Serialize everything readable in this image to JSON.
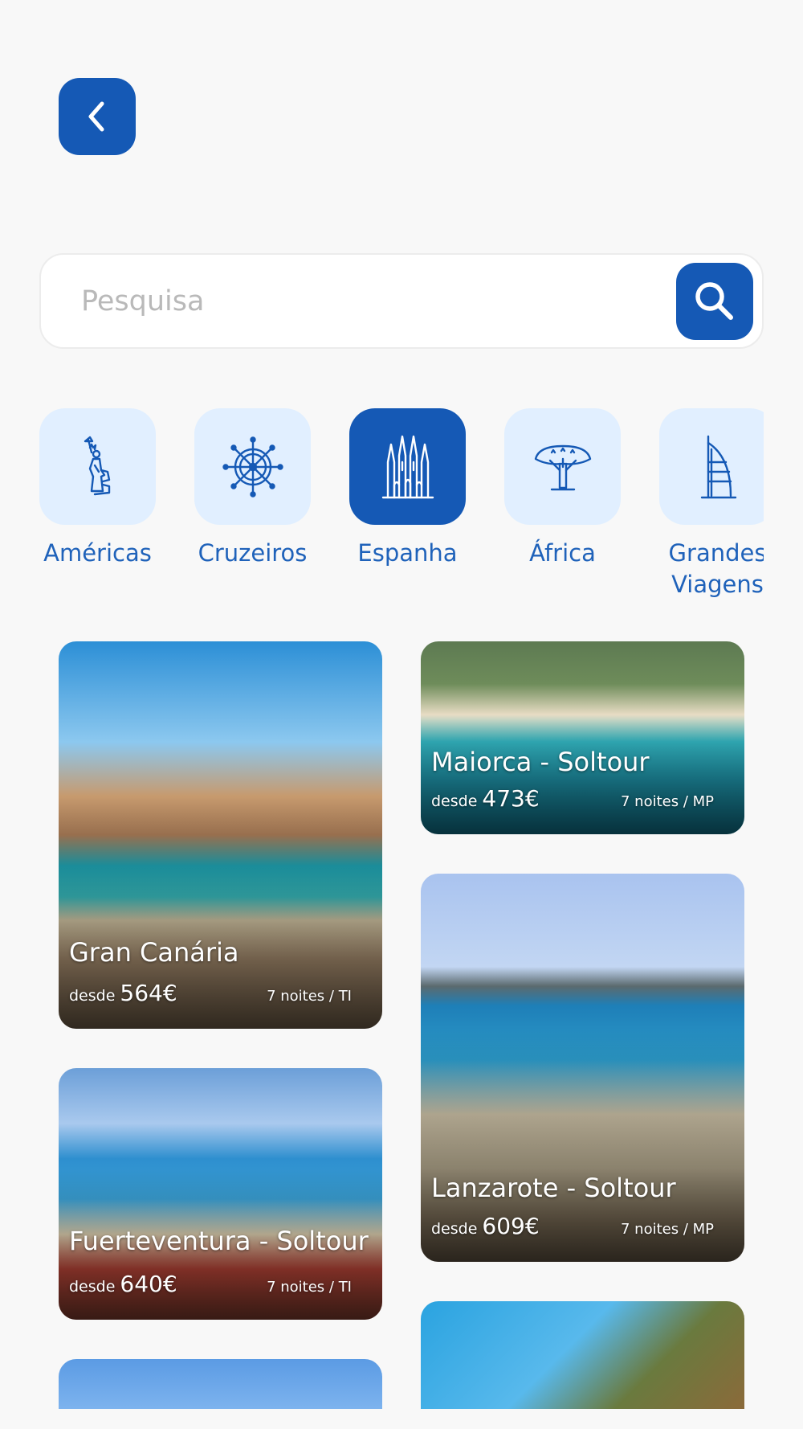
{
  "header": {
    "back_icon": "chevron-left-icon"
  },
  "search": {
    "placeholder": "Pesquisa",
    "value": "",
    "icon": "search-icon"
  },
  "categories": [
    {
      "label": "Américas",
      "icon": "statue-of-liberty-icon",
      "active": false
    },
    {
      "label": "Cruzeiros",
      "icon": "ship-wheel-icon",
      "active": false
    },
    {
      "label": "Espanha",
      "icon": "sagrada-familia-icon",
      "active": true
    },
    {
      "label": "África",
      "icon": "baobab-tree-icon",
      "active": false
    },
    {
      "label": "Grandes Viagens",
      "icon": "burj-al-arab-icon",
      "active": false
    }
  ],
  "offers": [
    {
      "title": "Gran Canária",
      "from_label": "desde",
      "price": "564€",
      "nights": "7 noites / TI"
    },
    {
      "title": "Maiorca - Soltour",
      "from_label": "desde",
      "price": "473€",
      "nights": "7 noites / MP"
    },
    {
      "title": "Fuerteventura - Soltour",
      "from_label": "desde",
      "price": "640€",
      "nights": "7 noites / TI"
    },
    {
      "title": "Lanzarote - Soltour",
      "from_label": "desde",
      "price": "609€",
      "nights": "7 noites / MP"
    }
  ],
  "colors": {
    "brand": "#1559b5",
    "tile": "#e1efff",
    "background": "#f8f8f8",
    "category_text": "#1f62ba"
  }
}
